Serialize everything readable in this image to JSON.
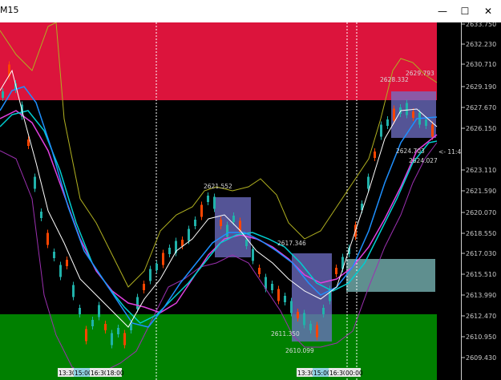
{
  "window": {
    "title": "M15",
    "minimize_glyph": "—",
    "maximize_glyph": "☐",
    "close_glyph": "✕"
  },
  "price_axis": {
    "labels": [
      "2633.750",
      "2632.230",
      "2630.710",
      "2629.190",
      "2627.670",
      "2626.150",
      "2623.110",
      "2621.590",
      "2620.070",
      "2618.550",
      "2617.030",
      "2615.510",
      "2613.990",
      "2612.470",
      "2610.950",
      "2609.430"
    ]
  },
  "current_price_marker": "<- 11:4",
  "annotations": [
    {
      "text": "2628.332"
    },
    {
      "text": "2629.793"
    },
    {
      "text": "2621.552"
    },
    {
      "text": "2617.346"
    },
    {
      "text": "2624.703"
    },
    {
      "text": "2624.027"
    },
    {
      "text": "2611.350"
    },
    {
      "text": "2610.099"
    }
  ],
  "time_labels": [
    "13:30",
    "15:00",
    "16:30",
    "18:00",
    "13:30",
    "15:00",
    "16:30",
    "00:00"
  ],
  "colors": {
    "resistance_zone": "#dc143c",
    "support_zone": "#008000",
    "box_zone": "#5f8f8f",
    "volume_boxes": "#7070c8",
    "ma_white": "#ffffff",
    "ma_blue": "#1e90ff",
    "ma_cyan": "#00ced1",
    "ma_magenta": "#e040e0",
    "envelope_yellow": "#b0b020",
    "envelope_purple": "#9b30b0",
    "bull_candle": "#20b2aa",
    "bear_candle": "#ff4500"
  }
}
